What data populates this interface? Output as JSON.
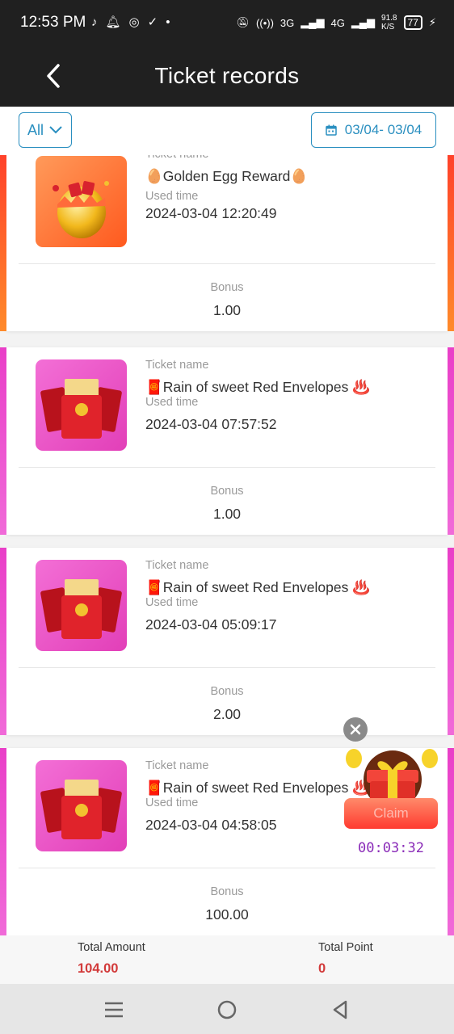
{
  "status_bar": {
    "time": "12:53 PM",
    "left_icons": [
      "tiktok-icon",
      "bell-icon",
      "app-icon",
      "check-icon",
      "dot-icon"
    ],
    "signal_labels": [
      "3G",
      "4G"
    ],
    "network_speed": "91.8",
    "network_unit": "K/S",
    "battery": "77"
  },
  "header": {
    "title": "Ticket records"
  },
  "filters": {
    "type_selected": "All",
    "date_range": "03/04- 03/04"
  },
  "labels": {
    "ticket_name": "Ticket name",
    "used_time": "Used time",
    "bonus": "Bonus"
  },
  "records": [
    {
      "ticket_name": "🥚Golden Egg Reward🥚",
      "used_time": "2024-03-04 12:20:49",
      "bonus": "1.00",
      "theme": "golden-egg",
      "accent": "#ff5a2a"
    },
    {
      "ticket_name": "🧧Rain of sweet Red Envelopes ♨️",
      "used_time": "2024-03-04 07:57:52",
      "bonus": "1.00",
      "theme": "red-envelope",
      "accent": "#e93fc8"
    },
    {
      "ticket_name": "🧧Rain of sweet Red Envelopes ♨️",
      "used_time": "2024-03-04 05:09:17",
      "bonus": "2.00",
      "theme": "red-envelope",
      "accent": "#e93fc8"
    },
    {
      "ticket_name": "🧧Rain of sweet Red Envelopes ♨️",
      "used_time": "2024-03-04 04:58:05",
      "bonus": "100.00",
      "theme": "red-envelope",
      "accent": "#e93fc8"
    }
  ],
  "totals": {
    "amount_label": "Total Amount",
    "amount_value": "104.00",
    "point_label": "Total Point",
    "point_value": "0"
  },
  "claim_widget": {
    "button_label": "Claim",
    "countdown": "00:03:32"
  },
  "colors": {
    "header_bg": "#202020",
    "accent_blue": "#2a8fc0",
    "total_red": "#d23a3a",
    "timer_purple": "#8a2bb8"
  }
}
